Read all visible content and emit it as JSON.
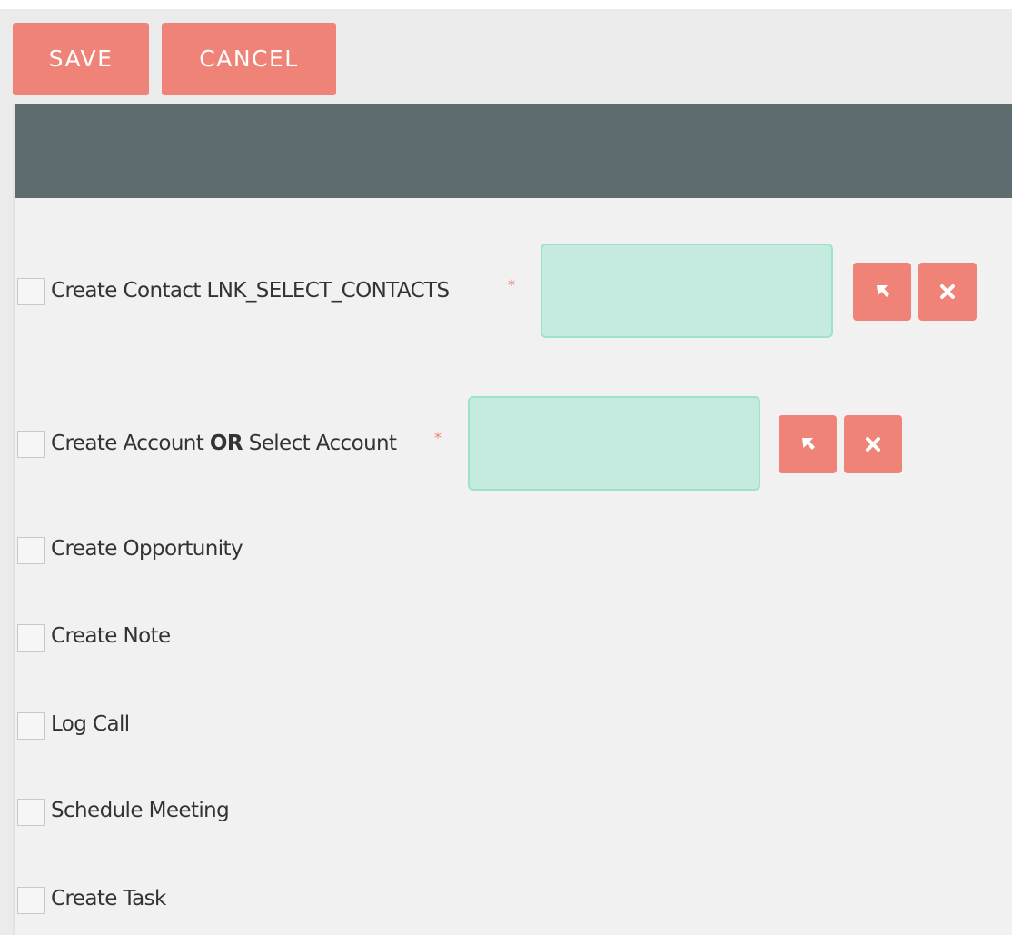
{
  "toolbar": {
    "save_label": "SAVE",
    "cancel_label": "CANCEL"
  },
  "rows": {
    "contact": {
      "label": "Create Contact LNK_SELECT_CONTACTS",
      "required": "*",
      "input_value": "",
      "select_icon": "arrow-pointer-icon",
      "clear_icon": "close-icon"
    },
    "account": {
      "label_part1": "Create Account",
      "label_or": "OR",
      "label_part2": "Select Account",
      "required": "*",
      "input_value": "",
      "select_icon": "arrow-pointer-icon",
      "clear_icon": "close-icon"
    },
    "opportunity": {
      "label": "Create Opportunity"
    },
    "note": {
      "label": "Create Note"
    },
    "call": {
      "label": "Log Call"
    },
    "meeting": {
      "label": "Schedule Meeting"
    },
    "task": {
      "label": "Create Task"
    }
  },
  "colors": {
    "accent": "#f08377",
    "header_bar": "#5e6b6f",
    "input_bg": "#c5eadf",
    "input_border": "#9ee2cc",
    "background": "#f1f1f1"
  }
}
